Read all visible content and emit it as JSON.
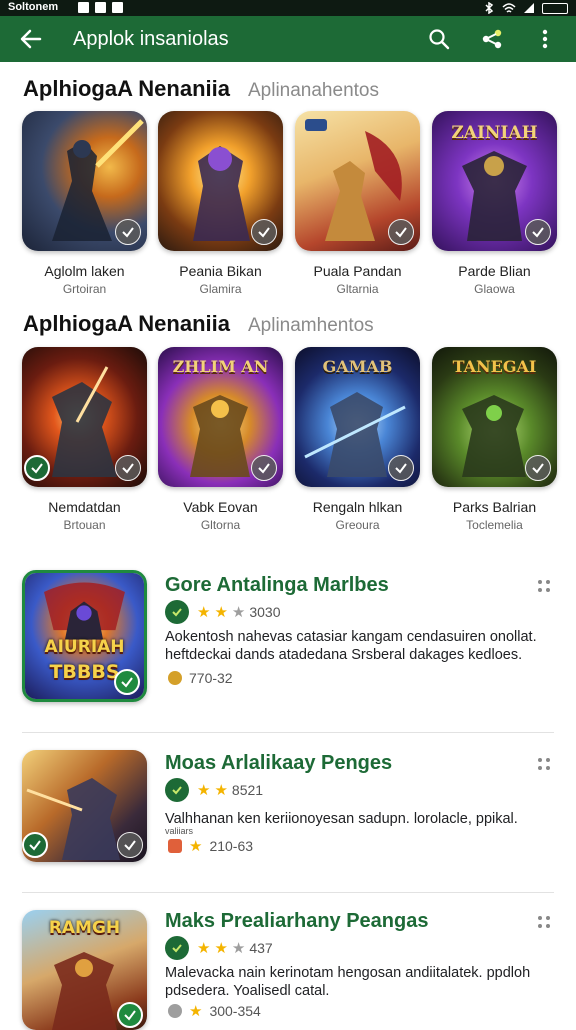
{
  "status_bar": {
    "carrier": "Soltonem"
  },
  "app_bar": {
    "title": "Applok insaniolas"
  },
  "sections": [
    {
      "title": "AplhiogaA Nenaniia",
      "subtitle": "Aplinanahentos",
      "cards": [
        {
          "name": "Aglolm laken",
          "category": "Grtoiran"
        },
        {
          "name": "Peania Bikan",
          "category": "Glamira"
        },
        {
          "name": "Puala Pandan",
          "category": "Gltarnia"
        },
        {
          "name": "Parde Blian",
          "category": "Glaowa",
          "art_text": "ZAINIAH"
        }
      ]
    },
    {
      "title": "AplhiogaA Nenaniia",
      "subtitle": "Aplinamhentos",
      "cards": [
        {
          "name": "Nemdatdan",
          "category": "Brtouan"
        },
        {
          "name": "Vabk Eovan",
          "category": "Gltorna",
          "art_text": "ZHLIM AN"
        },
        {
          "name": "Rengaln hlkan",
          "category": "Greoura",
          "art_text": "GAMAB"
        },
        {
          "name": "Parks Balrian",
          "category": "Toclemelia",
          "art_text": "TANEGAI"
        }
      ]
    }
  ],
  "list": [
    {
      "title": "Gore Antalinga Marlbes",
      "rating": "3030",
      "stars": 3,
      "description": "Aokentosh nahevas catasiar kangam cendasuiren onollat. heftdeckai dands atadedana Srsberal dakages kedloes.",
      "stat": "770-32",
      "art_text_top": "AIURIAH",
      "art_text_bottom": "TBBBS"
    },
    {
      "title": "Moas Arlalikaay Penges",
      "rating": "8521",
      "stars": 2,
      "description": "Valhhanan ken keriionoyesan sadupn. lorolacle, ppikal.",
      "stat": "210-63",
      "overflow_text": "valiiars"
    },
    {
      "title": "Maks Prealiarhany Peangas",
      "rating": "437",
      "stars": 3,
      "description": "Malevacka nain kerinotam hengosan andiitalatek. ppdloh pdsedera. Yoalisedl catal.",
      "stat": "300-354",
      "art_text": "RAMGH"
    }
  ]
}
